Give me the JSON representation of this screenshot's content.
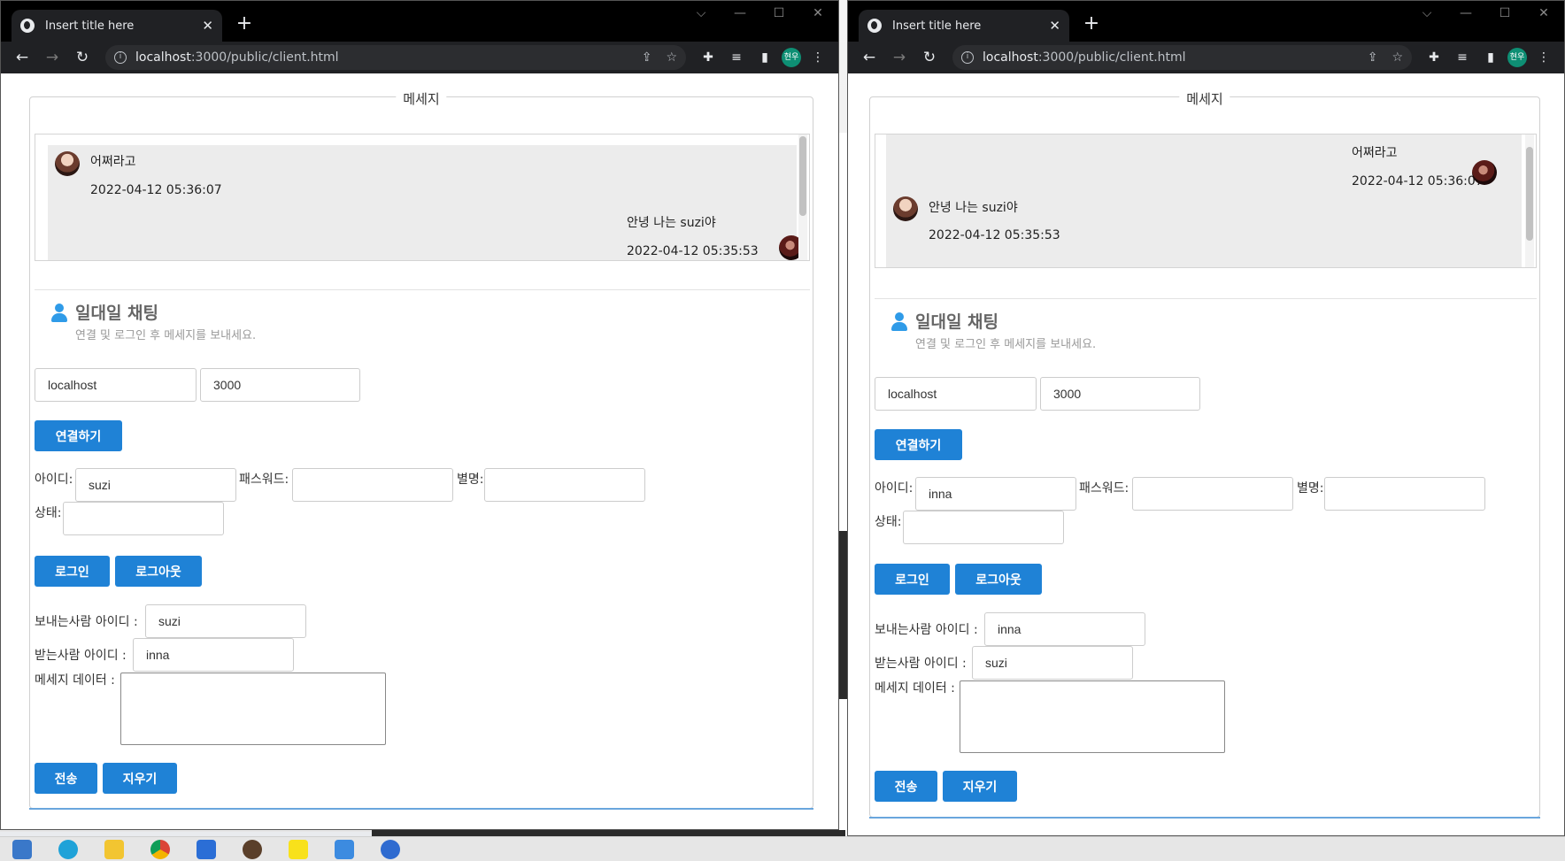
{
  "tab_title": "Insert title here",
  "url_host": "localhost",
  "url_path": ":3000/public/client.html",
  "profile": "현우",
  "legend": "메세지",
  "heading": {
    "title": "일대일 채팅",
    "subtitle": "연결 및 로그인 후 메세지를 보내세요."
  },
  "labels": {
    "id": "아이디:",
    "password": "패스워드:",
    "alias": "별명:",
    "status": "상태:",
    "sender": "보내는사람 아이디 :",
    "receiver": "받는사람 아이디 :",
    "message": "메세지 데이터 :"
  },
  "buttons": {
    "connect": "연결하기",
    "login": "로그인",
    "logout": "로그아웃",
    "send": "전송",
    "clear": "지우기"
  },
  "left": {
    "messages": [
      {
        "text": "어쩌라고",
        "time": "2022-04-12 05:36:07"
      },
      {
        "text": "안녕 나는 suzi야",
        "time": "2022-04-12 05:35:53"
      }
    ],
    "host": "localhost",
    "port": "3000",
    "id": "suzi",
    "sender": "suzi",
    "receiver": "inna"
  },
  "right": {
    "messages": [
      {
        "text": "어쩌라고",
        "time": "2022-04-12 05:36:07"
      },
      {
        "text": "안녕 나는 suzi야",
        "time": "2022-04-12 05:35:53"
      }
    ],
    "host": "localhost",
    "port": "3000",
    "id": "inna",
    "sender": "inna",
    "receiver": "suzi"
  },
  "colors": {
    "button": "#1f82d6",
    "accent_icon": "#2f9be8"
  }
}
